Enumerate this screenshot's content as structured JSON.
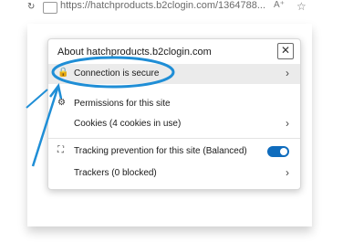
{
  "browser": {
    "url": "https://hatchproducts.b2clogin.com/1364788...",
    "read_aloud_label": "A⁺",
    "favorite_glyph": "☆"
  },
  "popup": {
    "title": "About hatchproducts.b2clogin.com",
    "close_glyph": "✕",
    "connection_label": "Connection is secure",
    "permissions_label": "Permissions for this site",
    "cookies_label": "Cookies (4 cookies in use)",
    "tracking_label": "Tracking prevention for this site (Balanced)",
    "trackers_label": "Trackers (0 blocked)",
    "chevron": "›",
    "lock_glyph": "🔒",
    "permissions_glyph": "⚙",
    "tracking_glyph": "⛶"
  },
  "colors": {
    "annotation": "#1f8ed6",
    "toggle_on": "#0f6cbd"
  }
}
